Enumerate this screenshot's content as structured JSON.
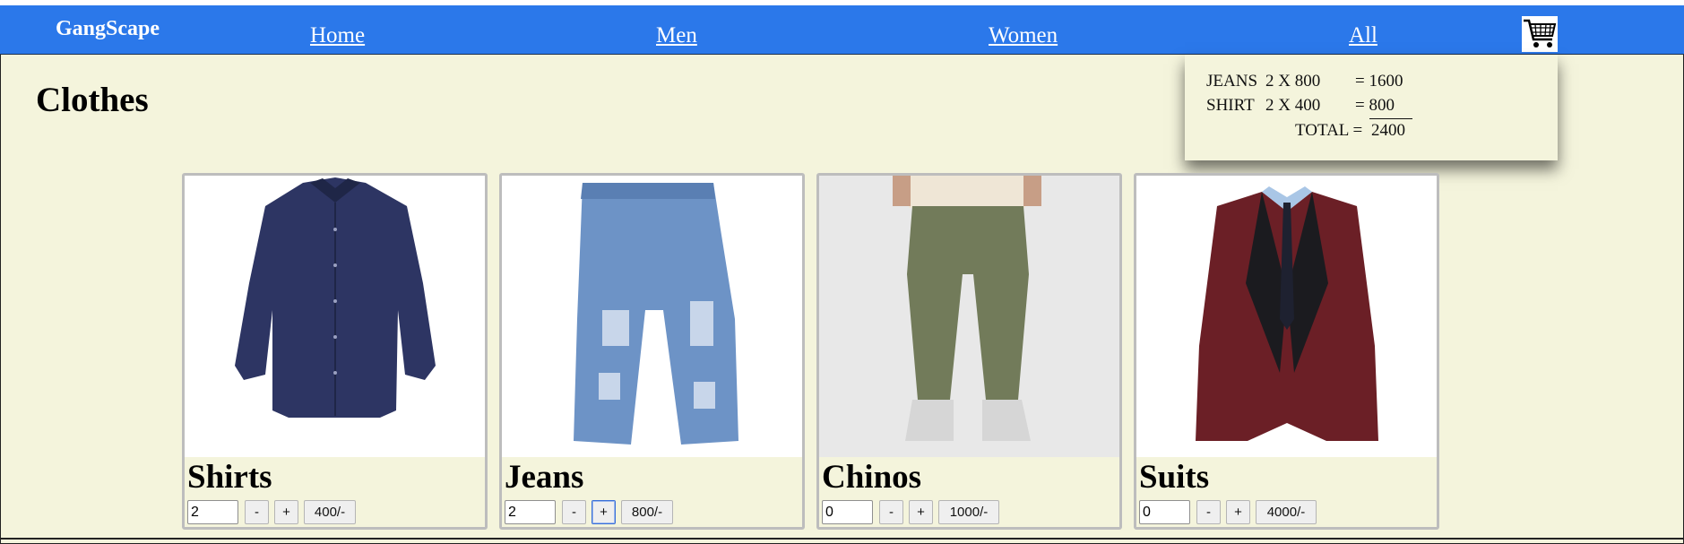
{
  "navbar": {
    "brand": "GangScape",
    "links": [
      "Home",
      "Men",
      "Women",
      "All"
    ]
  },
  "page": {
    "title": "Clothes"
  },
  "cart": {
    "lines": [
      {
        "item": "JEANS",
        "qty_price": "2 X 800",
        "equals": "= 1600"
      },
      {
        "item": "SHIRT",
        "qty_price": "2 X 400",
        "equals": "= 800"
      }
    ],
    "total_label": "TOTAL =",
    "total_value": "2400"
  },
  "products": [
    {
      "name": "Shirts",
      "qty": "2",
      "minus": "-",
      "plus": "+",
      "price": "400/-"
    },
    {
      "name": "Jeans",
      "qty": "2",
      "minus": "-",
      "plus": "+",
      "price": "800/-"
    },
    {
      "name": "Chinos",
      "qty": "0",
      "minus": "-",
      "plus": "+",
      "price": "1000/-"
    },
    {
      "name": "Suits",
      "qty": "0",
      "minus": "-",
      "plus": "+",
      "price": "4000/-"
    }
  ],
  "icons": {
    "cart": "shopping-cart-icon"
  },
  "colors": {
    "navbar": "#2b78ea",
    "background": "#f4f4dc"
  }
}
